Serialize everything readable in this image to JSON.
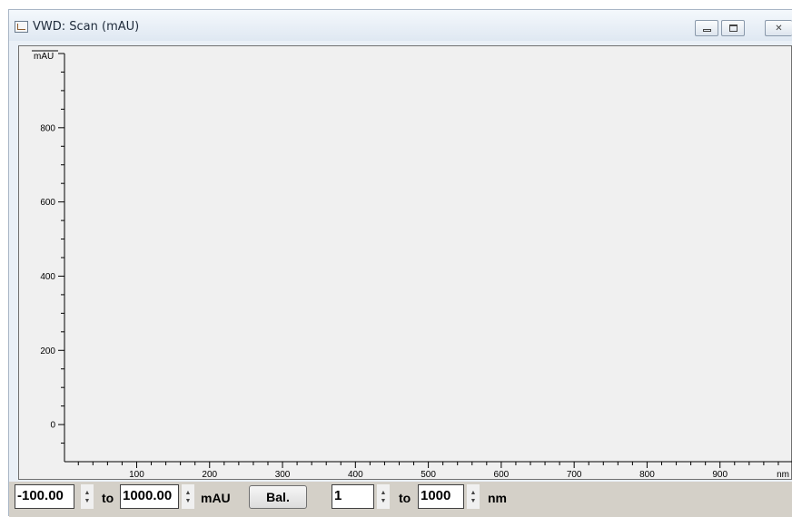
{
  "window": {
    "title": "VWD: Scan (mAU)"
  },
  "chart_data": {
    "type": "line",
    "ylabel": "mAU",
    "xlabel": "nm",
    "y_ticks": [
      "0",
      "200",
      "400",
      "600",
      "800"
    ],
    "x_ticks": [
      "100",
      "200",
      "300",
      "400",
      "500",
      "600",
      "700",
      "800",
      "900"
    ],
    "ylim": [
      -100,
      1000
    ],
    "xlim": [
      1,
      1000
    ],
    "grid": false,
    "series": []
  },
  "controls": {
    "y_min": "-100.00",
    "y_max": "1000.00",
    "to_label_1": "to",
    "y_unit": "mAU",
    "bal_label": "Bal.",
    "x_min": "1",
    "to_label_2": "to",
    "x_max": "1000",
    "x_unit": "nm",
    "spin_up": "▲",
    "spin_down": "▼"
  },
  "icons": {
    "app": "chart-window-icon",
    "minimize": "minimize-icon",
    "maximize": "maximize-icon",
    "close": "close-icon"
  }
}
